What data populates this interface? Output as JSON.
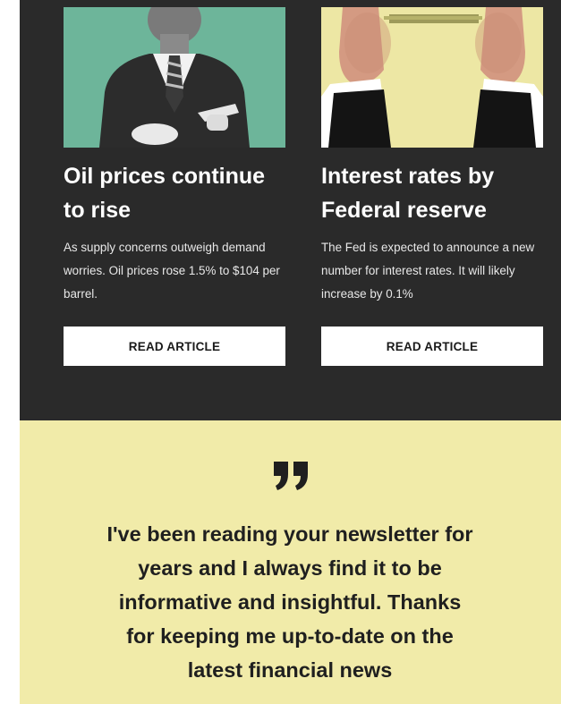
{
  "articles": [
    {
      "title": "Oil prices continue to rise",
      "body": "As supply concerns outweigh demand worries. Oil prices rose 1.5% to $104 per barrel.",
      "button_label": "READ ARTICLE",
      "image_icon": "businessman-pointing-image"
    },
    {
      "title": "Interest rates by Federal reserve",
      "body": "The Fed is expected to announce a new number for interest rates. It will likely increase by 0.1%",
      "button_label": "READ ARTICLE",
      "image_icon": "hands-holding-bar-image"
    }
  ],
  "testimonial": {
    "quote_icon": "quote-mark-icon",
    "text": "I've been reading your newsletter for years and I always find it to be informative and insightful. Thanks for keeping me up-to-date on the latest financial news"
  },
  "colors": {
    "dark_background": "#2a2a2a",
    "quote_background": "#f1eba9",
    "button_background": "#ffffff",
    "image1_background": "#6db59a",
    "image2_background": "#ede7a4"
  }
}
